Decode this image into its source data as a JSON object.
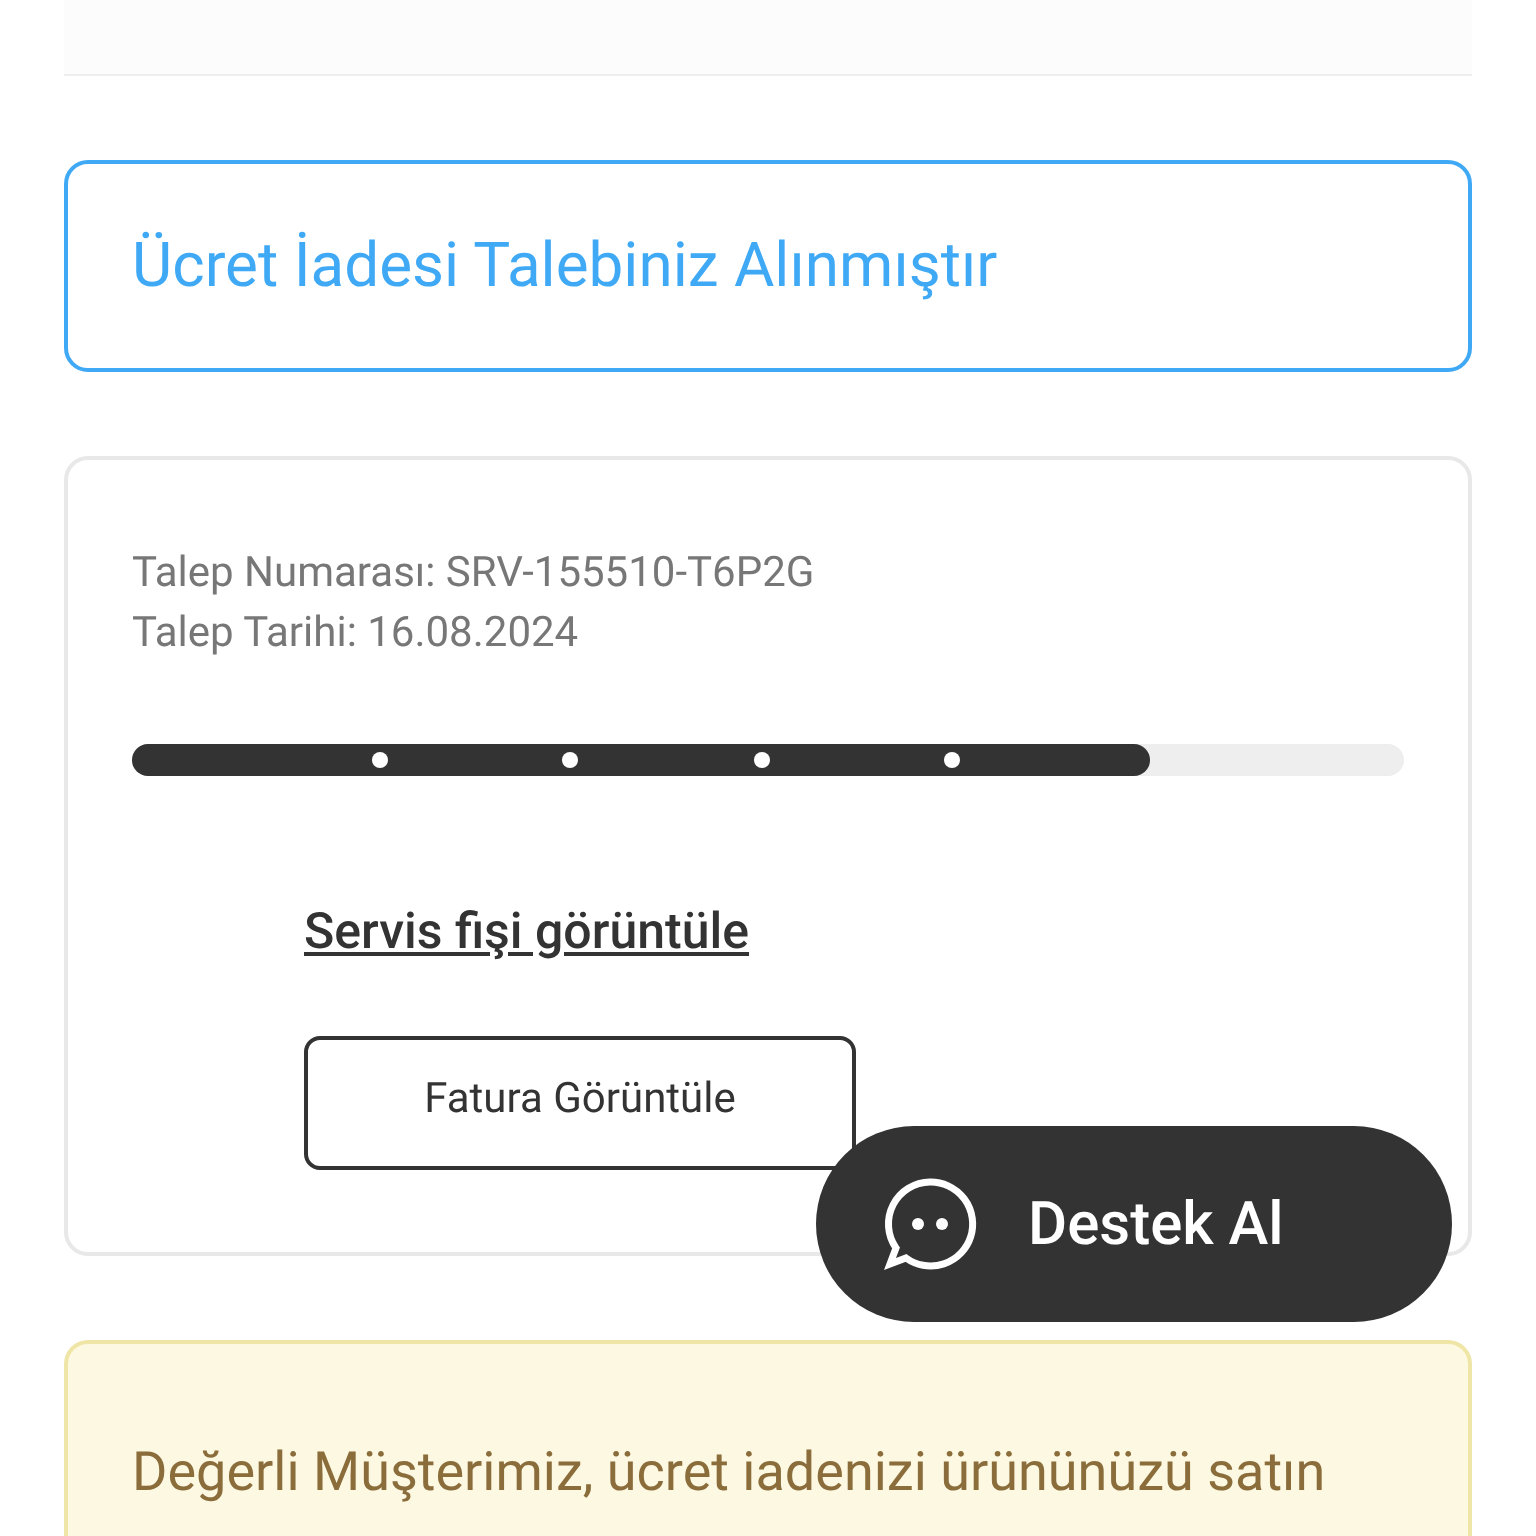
{
  "notice": {
    "title": "Ücret İadesi Talebiniz Alınmıştır"
  },
  "request": {
    "number": "Talep Numarası: SRV-155510-T6P2G",
    "date": "Talep Tarihi: 16.08.2024",
    "progress": {
      "level": 0.8
    },
    "service_link": "Servis fişi görüntüle",
    "invoice_button": "Fatura Görüntüle"
  },
  "support_button": "Destek Al",
  "info": {
    "text": "Değerli Müşterimiz, ücret iadenizi ürününüzü satın"
  }
}
